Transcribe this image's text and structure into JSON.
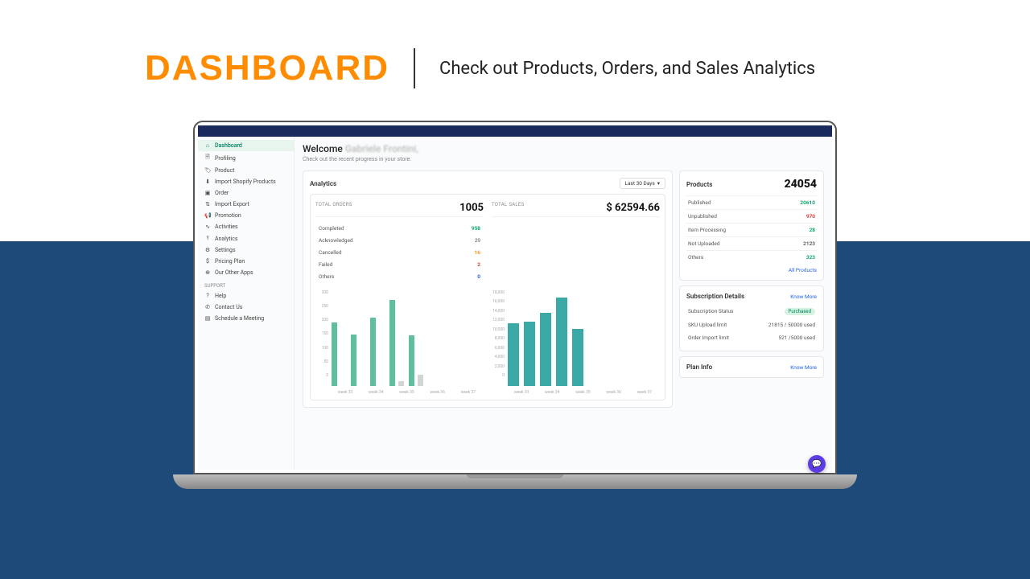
{
  "hero": {
    "title": "DASHBOARD",
    "subtitle": "Check out Products, Orders, and Sales Analytics"
  },
  "sidebar": {
    "items": [
      {
        "icon": "⌂",
        "label": "Dashboard",
        "active": true
      },
      {
        "icon": "🗎",
        "label": "Profiling"
      },
      {
        "icon": "🏷",
        "label": "Product"
      },
      {
        "icon": "⬇",
        "label": "Import Shopify Products"
      },
      {
        "icon": "▣",
        "label": "Order"
      },
      {
        "icon": "⇅",
        "label": "Import Export"
      },
      {
        "icon": "📢",
        "label": "Promotion"
      },
      {
        "icon": "∿",
        "label": "Activities"
      },
      {
        "icon": "⫯",
        "label": "Analytics"
      },
      {
        "icon": "⚙",
        "label": "Settings"
      },
      {
        "icon": "$",
        "label": "Pricing Plan"
      },
      {
        "icon": "⊕",
        "label": "Our Other Apps"
      }
    ],
    "support_label": "SUPPORT",
    "support": [
      {
        "icon": "?",
        "label": "Help"
      },
      {
        "icon": "✆",
        "label": "Contact Us"
      },
      {
        "icon": "▤",
        "label": "Schedule a Meeting"
      }
    ]
  },
  "header": {
    "welcome": "Welcome",
    "name": "Gabriele Frontini,",
    "subtext": "Check out the recent progress in your store."
  },
  "analytics": {
    "title": "Analytics",
    "range": "Last 30 Days",
    "orders_label": "TOTAL ORDERS",
    "orders_value": "1005",
    "sales_label": "TOTAL SALES",
    "sales_value": "$ 62594.66",
    "status": [
      {
        "label": "Completed",
        "value": "958",
        "cls": "v-green"
      },
      {
        "label": "Acknowledged",
        "value": "29",
        "cls": ""
      },
      {
        "label": "Cancelled",
        "value": "16",
        "cls": "v-orange"
      },
      {
        "label": "Failed",
        "value": "2",
        "cls": "v-red"
      },
      {
        "label": "Others",
        "value": "0",
        "cls": "v-blue"
      }
    ]
  },
  "chart_data": [
    {
      "type": "bar",
      "categories": [
        "week 33",
        "week 34",
        "week 35",
        "week 36",
        "week 37"
      ],
      "series": [
        {
          "name": "Completed",
          "values": [
            200,
            162,
            215,
            270,
            160
          ]
        },
        {
          "name": "Other",
          "values": [
            0,
            0,
            0,
            15,
            35
          ]
        }
      ],
      "ylim": [
        0,
        300
      ],
      "ticks": [
        0,
        50,
        100,
        150,
        200,
        250,
        300
      ]
    },
    {
      "type": "bar",
      "categories": [
        "week 33",
        "week 34",
        "week 35",
        "week 36",
        "week 37"
      ],
      "values": [
        11800,
        12100,
        13800,
        16700,
        10700
      ],
      "title": "Total Sales",
      "ylim": [
        0,
        18000
      ],
      "ticks": [
        0,
        2000,
        4000,
        6000,
        8000,
        10000,
        12000,
        14000,
        16000,
        18000
      ]
    }
  ],
  "products": {
    "title": "Products",
    "total": "24054",
    "rows": [
      {
        "label": "Published",
        "value": "20610",
        "cls": "v-green"
      },
      {
        "label": "Unpublished",
        "value": "970",
        "cls": "v-red"
      },
      {
        "label": "Item Processing",
        "value": "28",
        "cls": "v-green"
      },
      {
        "label": "Not Uploaded",
        "value": "2123",
        "cls": ""
      },
      {
        "label": "Others",
        "value": "323",
        "cls": "v-green"
      }
    ],
    "link": "All Products"
  },
  "subscription": {
    "title": "Subscription Details",
    "link": "Know More",
    "status_label": "Subscription Status",
    "status_value": "Purchased",
    "rows": [
      {
        "label": "SKU Upload limit",
        "value": "21815 / 50000 used"
      },
      {
        "label": "Order Import limit",
        "value": "521 /5000 used"
      }
    ]
  },
  "plan": {
    "title": "Plan Info",
    "link": "Know More"
  }
}
